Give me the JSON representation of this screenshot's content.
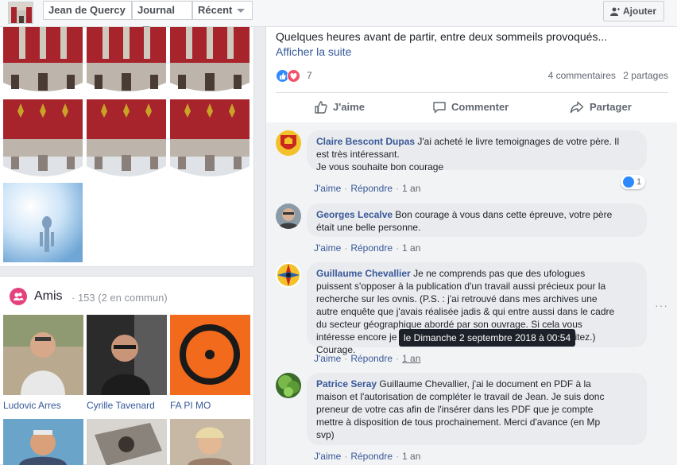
{
  "topbar": {
    "profile_name": "Jean de Quercy",
    "journal_label": "Journal",
    "recent_label": "Récent",
    "add_label": "Ajouter"
  },
  "friends": {
    "title": "Amis",
    "count": "· 153 (2 en commun)",
    "items": [
      {
        "name": "Ludovic Arres"
      },
      {
        "name": "Cyrille Tavenard"
      },
      {
        "name": "FA PI MO"
      }
    ]
  },
  "post": {
    "text": "Quelques heures avant de partir, entre deux sommeils provoqués...",
    "see_more": "Afficher la suite",
    "reactions_count": "7",
    "comments_count": "4 commentaires",
    "shares_count": "2 partages",
    "actions": {
      "like": "J'aime",
      "comment": "Commenter",
      "share": "Partager"
    }
  },
  "comments": [
    {
      "author": "Claire Bescont Dupas",
      "lines": [
        "J'ai acheté le livre temoignages de votre père. Il",
        "est très intéressant.",
        "Je vous souhaite bon courage"
      ],
      "like": "J'aime",
      "reply": "Répondre",
      "time": "1 an",
      "reaction_count": "1"
    },
    {
      "author": "Georges Lecalve",
      "lines": [
        "Bon courage à vous dans cette épreuve, votre père",
        "était une belle personne."
      ],
      "like": "J'aime",
      "reply": "Répondre",
      "time": "1 an"
    },
    {
      "author": "Guillaume Chevallier",
      "lines": [
        "Je ne comprends pas que des ufologues",
        "puissent s'opposer à la publication d'un travail aussi précieux pour la",
        "recherche sur les ovnis. (P.S. : j'ai retrouvé dans mes archives une",
        "autre enquête que j'avais réalisée jadis & qui entre aussi dans le cadre",
        "du secteur géographique abordé par son ouvrage. Si cela vous",
        "intéresse encore je peux vous la transmettre si vous le souhaitez.) Courage."
      ],
      "like": "J'aime",
      "reply": "Répondre",
      "time": "1 an"
    },
    {
      "author": "Patrice Seray",
      "lines": [
        "Guillaume Chevallier, j'ai le document en PDF à la",
        "maison et l'autorisation de compléter le travail de Jean. Je suis donc",
        "preneur de votre cas afin de l'insérer dans les PDF que je compte",
        "mettre à disposition de tous prochainement. Merci d'avance (en Mp",
        "svp)"
      ],
      "like": "J'aime",
      "reply": "Répondre",
      "time": "1 an"
    }
  ],
  "tooltip": "le Dimanche 2 septembre 2018 à 00:54",
  "colors": {
    "link": "#385898",
    "page_bg": "#e9ebee",
    "bubble": "#e9ebee",
    "friends_icon": "#e4417d",
    "like_blue": "#2e89ff",
    "love_red": "#f25268"
  }
}
